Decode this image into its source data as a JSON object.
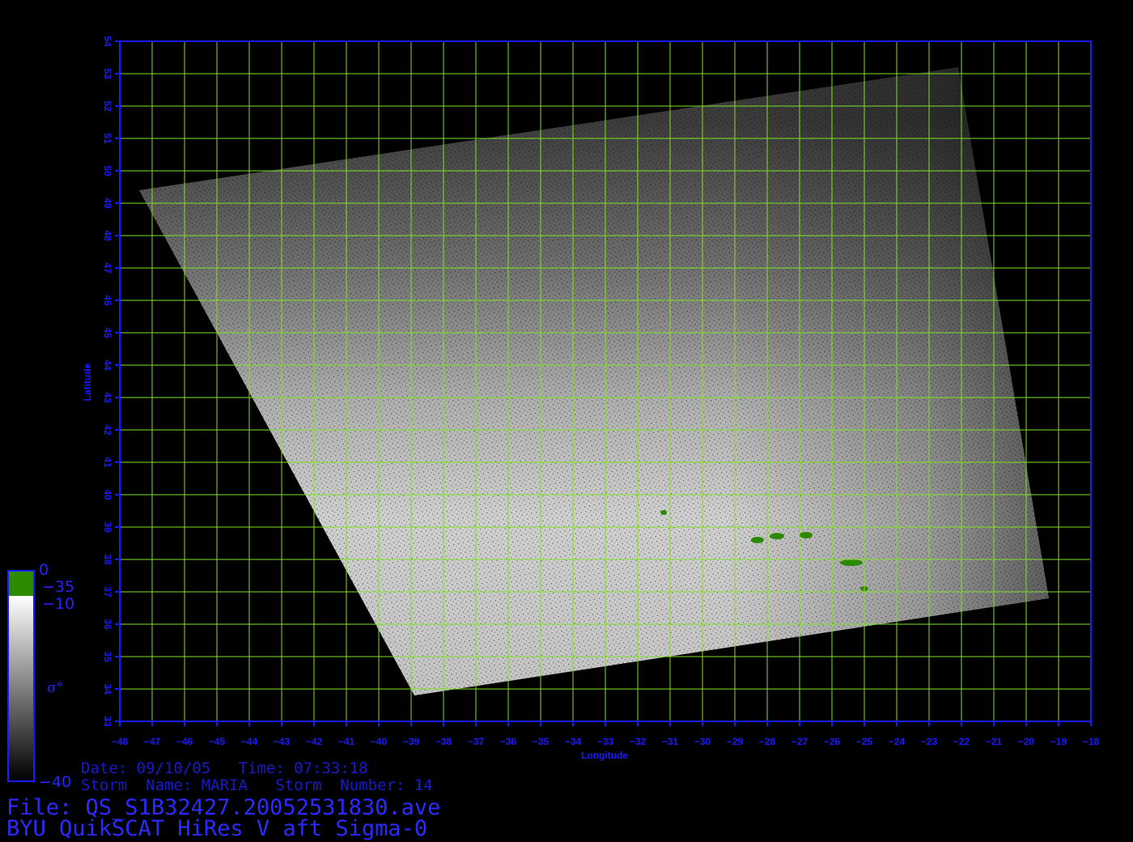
{
  "map": {
    "xlabel": "Longitude",
    "ylabel": "Latitude",
    "xlim": [
      -48,
      -18
    ],
    "ylim": [
      33,
      54
    ],
    "lon_ticks": [
      -48,
      -47,
      -46,
      -45,
      -44,
      -43,
      -42,
      -41,
      -40,
      -39,
      -38,
      -37,
      -36,
      -35,
      -34,
      -33,
      -32,
      -31,
      -30,
      -29,
      -28,
      -27,
      -26,
      -25,
      -24,
      -23,
      -22,
      -21,
      -20,
      -19,
      -18
    ],
    "lat_ticks": [
      33,
      34,
      35,
      36,
      37,
      38,
      39,
      40,
      41,
      42,
      43,
      44,
      45,
      46,
      47,
      48,
      49,
      50,
      51,
      52,
      53,
      54
    ],
    "grid": true,
    "swath_corners_lonlat": [
      [
        -47.4,
        49.4
      ],
      [
        -22.1,
        53.2
      ],
      [
        -19.3,
        36.8
      ],
      [
        -38.9,
        33.8
      ]
    ],
    "land_patches_lonlat": [
      [
        -31.2,
        39.45
      ],
      [
        -28.3,
        38.6
      ],
      [
        -27.7,
        38.72
      ],
      [
        -26.8,
        38.75
      ],
      [
        -25.4,
        37.9
      ],
      [
        -25.0,
        37.1
      ]
    ]
  },
  "colorbar": {
    "top_label": "0",
    "mid_label_1": "−35",
    "mid_label_2": "−10",
    "bottom_label": "−40",
    "quantity_symbol": "σ°",
    "green_color": "#2e8b00",
    "white_color": "#ffffff",
    "black_color": "#000000"
  },
  "info": {
    "date_line": "Date: 09/10/05   Time: 07:33:18",
    "storm_line": "Storm  Name: MARIA   Storm  Number: 14",
    "file_line": "File: QS_S1B32427.20052531830.ave",
    "title_line": "BYU QuikSCAT HiRes V aft Sigma-0"
  },
  "colors": {
    "axis_blue": "#1a1aff",
    "grid_green": "#80e020",
    "land_green": "#2d8a00"
  }
}
